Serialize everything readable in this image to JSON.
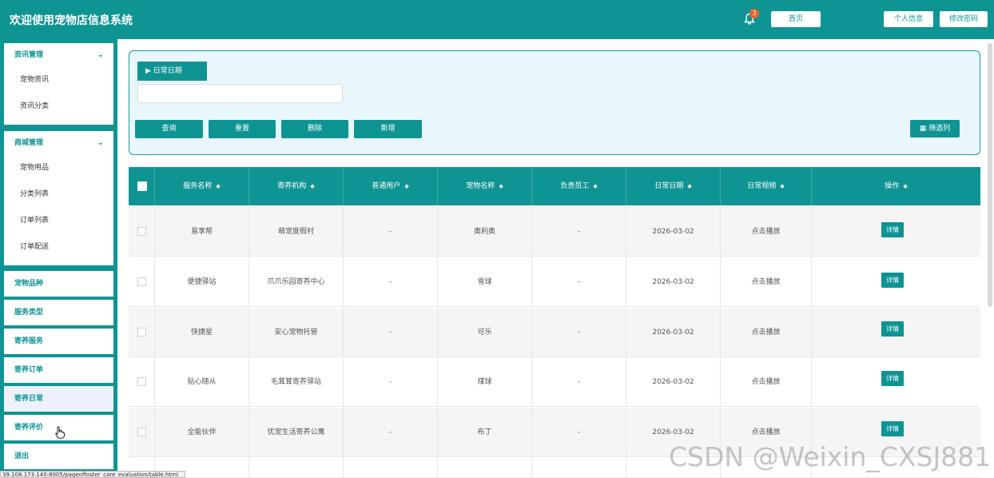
{
  "header": {
    "title": "欢迎使用宠物店信息系统",
    "notification_count": "3",
    "home_label": "首页",
    "profile_label": "个人信息",
    "password_label": "修改密码"
  },
  "sidebar": {
    "groups": [
      {
        "label": "资讯管理",
        "items": [
          "宠物资讯",
          "资讯分类"
        ]
      },
      {
        "label": "商城管理",
        "items": [
          "宠物用品",
          "分类列表",
          "订单列表",
          "订单配送"
        ]
      }
    ],
    "items": [
      "宠物品种",
      "服务类型",
      "寄养服务",
      "寄养订单",
      "寄养日常",
      "寄养评价",
      "退出"
    ]
  },
  "search": {
    "date_label": "▶ 日常日期",
    "date_value": "",
    "buttons": [
      "查询",
      "重置",
      "删除",
      "新增"
    ],
    "filter_label": "筛选列"
  },
  "table": {
    "columns": [
      "服务名称",
      "寄养机构",
      "普通用户",
      "宠物名称",
      "负责员工",
      "日常日期",
      "日常视频",
      "操作"
    ],
    "detail_label": "详情",
    "rows": [
      [
        "易享帮",
        "萌宠度假村",
        "-",
        "奥利奥",
        "-",
        "2026-03-02",
        "点击播放"
      ],
      [
        "便捷驿站",
        "爪爪乐园寄养中心",
        "-",
        "雪球",
        "-",
        "2026-03-02",
        "点击播放"
      ],
      [
        "快捷星",
        "安心宠物托管",
        "-",
        "可乐",
        "-",
        "2026-03-02",
        "点击播放"
      ],
      [
        "贴心随从",
        "毛茸茸寄养驿站",
        "-",
        "煤球",
        "-",
        "2026-03-02",
        "点击播放"
      ],
      [
        "全能伙伴",
        "优宠生活寄养公寓",
        "-",
        "布丁",
        "-",
        "2026-03-02",
        "点击播放"
      ]
    ]
  },
  "status_bar": {
    "url": "39.108.173.140:8005/pageoffoster_care_evaluation/table.html"
  },
  "watermark": "CSDN @Weixin_CXSJ881",
  "colors": {
    "primary": "#0f9494",
    "panel": "#e9f7fc",
    "badge": "#e8632a"
  }
}
